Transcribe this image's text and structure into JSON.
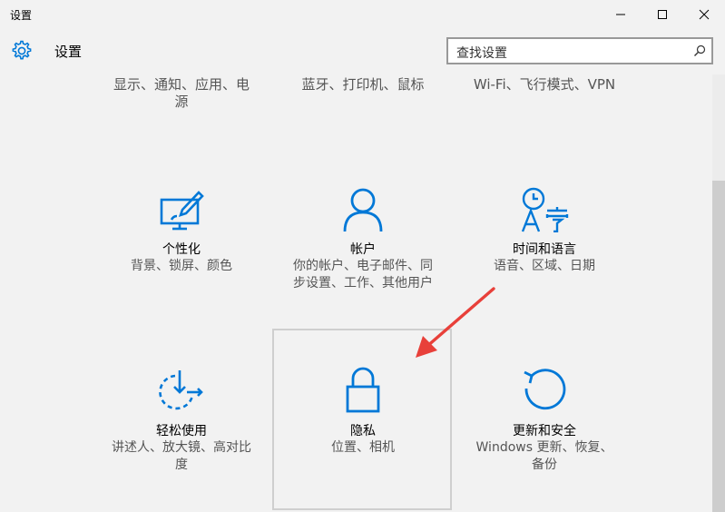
{
  "window": {
    "title": "设置"
  },
  "header": {
    "app_title": "设置",
    "search_placeholder": "查找设置"
  },
  "top_row": [
    {
      "desc": "显示、通知、应用、电源"
    },
    {
      "desc": "蓝牙、打印机、鼠标"
    },
    {
      "desc": "Wi-Fi、飞行模式、VPN"
    }
  ],
  "tiles": [
    {
      "label": "个性化",
      "desc": "背景、锁屏、颜色",
      "icon": "personalization-icon"
    },
    {
      "label": "帐户",
      "desc": "你的帐户、电子邮件、同步设置、工作、其他用户",
      "icon": "accounts-icon"
    },
    {
      "label": "时间和语言",
      "desc": "语音、区域、日期",
      "icon": "time-language-icon"
    },
    {
      "label": "轻松使用",
      "desc": "讲述人、放大镜、高对比度",
      "icon": "ease-of-access-icon"
    },
    {
      "label": "隐私",
      "desc": "位置、相机",
      "icon": "privacy-lock-icon"
    },
    {
      "label": "更新和安全",
      "desc": "Windows 更新、恢复、备份",
      "icon": "update-security-icon"
    }
  ],
  "colors": {
    "accent": "#0078d7",
    "annotation_arrow": "#e8403a",
    "background": "#f2f2f2"
  }
}
